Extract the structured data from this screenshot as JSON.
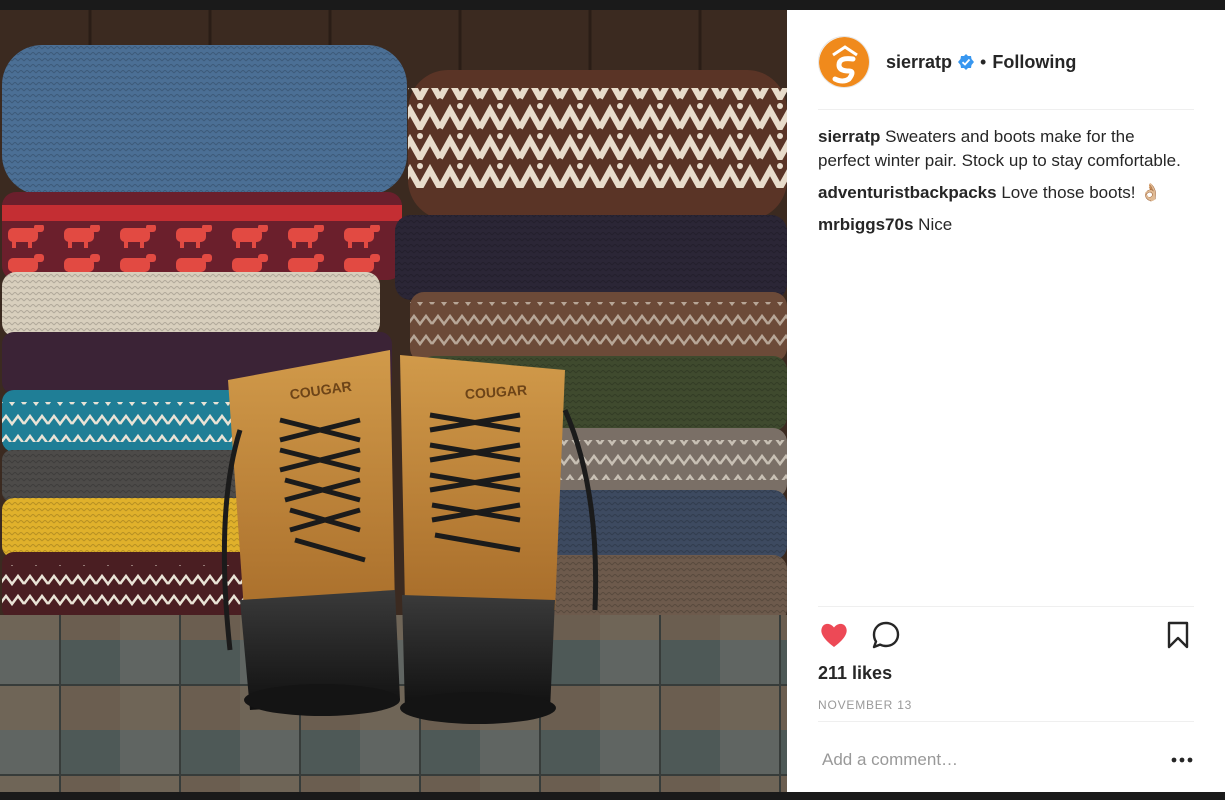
{
  "post": {
    "image_alt": "Stacks of folded knit sweaters with a pair of tan Cougar duck boots on a slate floor",
    "boot_brand": "COUGAR"
  },
  "header": {
    "username": "sierratp",
    "verified": true,
    "separator": "•",
    "follow_status": "Following"
  },
  "comments": [
    {
      "user": "sierratp",
      "text": "Sweaters and boots make for the perfect winter pair. Stock up to stay comfortable."
    },
    {
      "user": "adventuristbackpacks",
      "text": "Love those boots! 👌🏼"
    },
    {
      "user": "mrbiggs70s",
      "text": "Nice"
    }
  ],
  "actions": {
    "like_icon": "heart-filled-icon",
    "comment_icon": "speech-bubble-icon",
    "save_icon": "bookmark-icon",
    "liked_color": "#ed4956"
  },
  "likes_text": "211 likes",
  "date_text": "NOVEMBER 13",
  "add_comment": {
    "placeholder": "Add a comment…",
    "more_icon": "ellipsis-icon"
  },
  "colors": {
    "brand_orange": "#f08a1c",
    "verified_blue": "#3897f0"
  }
}
